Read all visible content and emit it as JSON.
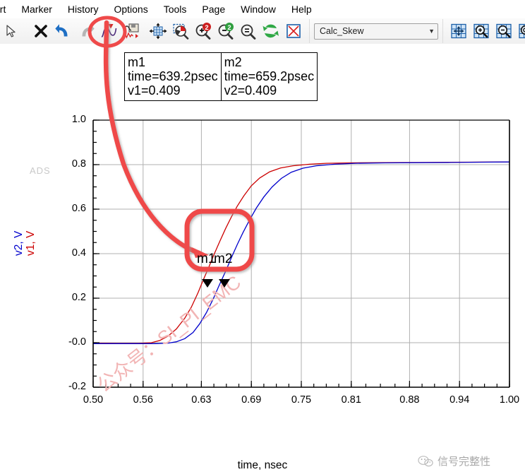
{
  "menu": {
    "items": [
      {
        "label": "ert",
        "name": "menu-insert"
      },
      {
        "label": "Marker",
        "name": "menu-marker"
      },
      {
        "label": "History",
        "name": "menu-history"
      },
      {
        "label": "Options",
        "name": "menu-options"
      },
      {
        "label": "Tools",
        "name": "menu-tools"
      },
      {
        "label": "Page",
        "name": "menu-page"
      },
      {
        "label": "Window",
        "name": "menu-window"
      },
      {
        "label": "Help",
        "name": "menu-help"
      }
    ]
  },
  "toolbar": {
    "icons": [
      "pointer-icon",
      "delete-x-icon",
      "undo-icon",
      "redo-icon",
      "marker-curve-icon",
      "save-marker-icon",
      "pan-icon",
      "zoom-area-icon",
      "zoom-in-2-icon",
      "zoom-out-2-icon",
      "zoom-equal-icon",
      "refresh-icon",
      "delete-box-icon",
      "grid-pan-icon",
      "grid-zoom-in-icon",
      "grid-zoom-out-icon",
      "grid-zoom-fit-icon"
    ],
    "combo": {
      "value": "Calc_Skew",
      "placeholder": "Calc_Skew",
      "arrow": "▼"
    },
    "highlighted_icon": "marker-curve-icon"
  },
  "markers_table": {
    "m1": {
      "name": "m1",
      "time": "time=639.2psec",
      "value": "v1=0.409"
    },
    "m2": {
      "name": "m2",
      "time": "time=659.2psec",
      "value": "v2=0.409"
    }
  },
  "plot_markers": {
    "m1_label": "m1",
    "m2_label": "m2",
    "glyph": "▼"
  },
  "watermarks": {
    "ads": "ADS",
    "diagonal": "公众号：SI_PI_EMC",
    "wechat": "信号完整性"
  },
  "axis_labels": {
    "y_blue": "v2, V",
    "y_red": "v1, V",
    "x": "time, nsec"
  },
  "colors": {
    "curve_v1": "#cc0000",
    "curve_v2": "#0000cc",
    "annotation": "#ef4a4a",
    "grid": "#b0b0b0",
    "axis": "#000000",
    "watermark_pink": "#f2b5b5",
    "watermark_gray": "#c9c9c9"
  },
  "chart_data": {
    "type": "line",
    "title": "",
    "xlabel": "time, nsec",
    "ylabel": "v2, V / v1, V",
    "xlim": [
      0.5,
      1.0
    ],
    "ylim": [
      -0.2,
      1.0
    ],
    "xticks": [
      0.5,
      0.56,
      0.63,
      0.69,
      0.75,
      0.81,
      0.88,
      0.94,
      1.0
    ],
    "xtick_labels": [
      "0.50",
      "0.56",
      "0.63",
      "0.69",
      "0.75",
      "0.81",
      "0.88",
      "0.94",
      "1.00"
    ],
    "yticks": [
      -0.2,
      0.0,
      0.2,
      0.4,
      0.6,
      0.8,
      1.0
    ],
    "ytick_labels": [
      "-0.2",
      "-0.0",
      "0.2",
      "0.4",
      "0.6",
      "0.8",
      "1.0"
    ],
    "grid": true,
    "minor_ticks_per_interval": 4,
    "legend": "none",
    "series": [
      {
        "name": "v1, V",
        "color": "#cc0000",
        "x": [
          0.5,
          0.53,
          0.555,
          0.57,
          0.58,
          0.59,
          0.6,
          0.61,
          0.618,
          0.626,
          0.632,
          0.639,
          0.645,
          0.652,
          0.659,
          0.666,
          0.673,
          0.681,
          0.69,
          0.7,
          0.712,
          0.725,
          0.74,
          0.76,
          0.78,
          0.81,
          0.85,
          0.9,
          0.95,
          1.0
        ],
        "y": [
          -0.002,
          -0.003,
          -0.003,
          0.0,
          0.01,
          0.03,
          0.062,
          0.11,
          0.16,
          0.225,
          0.28,
          0.34,
          0.395,
          0.455,
          0.512,
          0.565,
          0.613,
          0.66,
          0.705,
          0.74,
          0.768,
          0.785,
          0.795,
          0.802,
          0.806,
          0.808,
          0.809,
          0.81,
          0.811,
          0.812
        ]
      },
      {
        "name": "v2, V",
        "color": "#0000cc",
        "x": [
          0.5,
          0.54,
          0.575,
          0.59,
          0.6,
          0.61,
          0.62,
          0.628,
          0.636,
          0.644,
          0.651,
          0.659,
          0.666,
          0.673,
          0.68,
          0.688,
          0.696,
          0.705,
          0.715,
          0.726,
          0.738,
          0.752,
          0.768,
          0.79,
          0.815,
          0.85,
          0.89,
          0.93,
          0.965,
          1.0
        ],
        "y": [
          -0.004,
          -0.004,
          -0.004,
          -0.002,
          0.004,
          0.018,
          0.046,
          0.085,
          0.135,
          0.195,
          0.255,
          0.32,
          0.382,
          0.44,
          0.495,
          0.552,
          0.605,
          0.655,
          0.7,
          0.738,
          0.766,
          0.784,
          0.795,
          0.802,
          0.806,
          0.808,
          0.809,
          0.81,
          0.811,
          0.812
        ]
      }
    ],
    "markers": [
      {
        "label": "m1",
        "x": 0.6392,
        "y": 0.409,
        "series": "v1, V"
      },
      {
        "label": "m2",
        "x": 0.6592,
        "y": 0.409,
        "series": "v2, V"
      }
    ]
  }
}
